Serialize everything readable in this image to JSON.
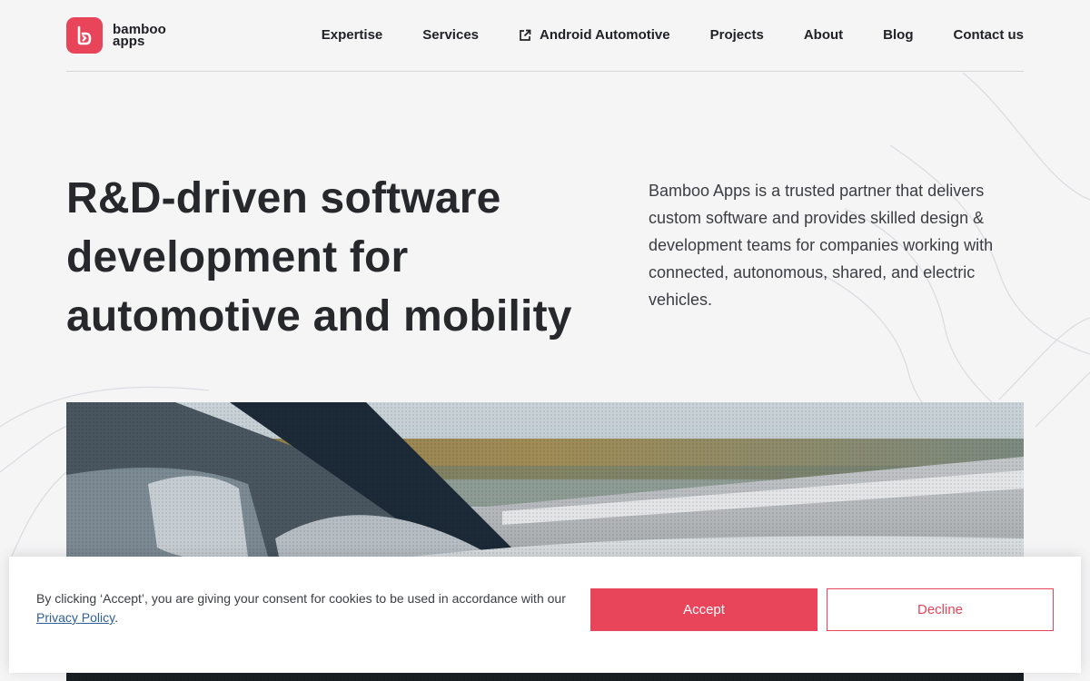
{
  "brand": {
    "logo_line1": "bamboo",
    "logo_line2": "apps",
    "accent_color": "#e8455a"
  },
  "nav": {
    "items": [
      {
        "label": "Expertise"
      },
      {
        "label": "Services"
      },
      {
        "label": "Android Automotive",
        "icon": "external-link-icon"
      },
      {
        "label": "Projects"
      },
      {
        "label": "About"
      },
      {
        "label": "Blog"
      },
      {
        "label": "Contact us"
      }
    ]
  },
  "hero": {
    "title": "R&D-driven software development for automotive and mobility",
    "description": "Bamboo Apps is a trusted partner that delivers custom software and provides skilled design & development teams for companies working with connected, autonomous, shared, and electric vehicles."
  },
  "cookie": {
    "text_before": "By clicking ‘Accept’, you are giving your consent for cookies to be used in accordance with our ",
    "link": "Privacy Policy",
    "text_after": ".",
    "accept_label": "Accept",
    "decline_label": "Decline"
  }
}
